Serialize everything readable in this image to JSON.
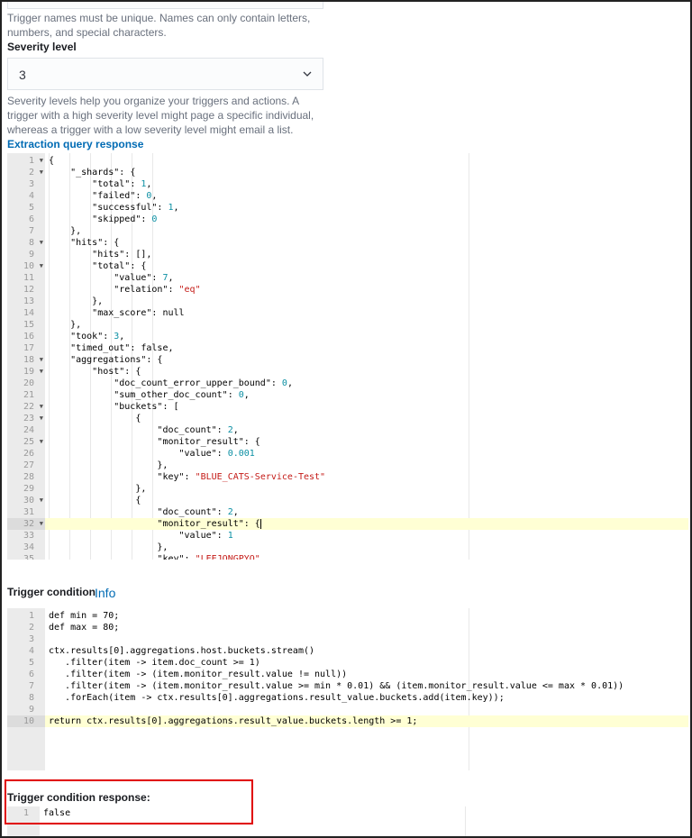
{
  "trigger_name": {
    "help_text": "Trigger names must be unique. Names can only contain letters, numbers, and special characters."
  },
  "severity": {
    "label": "Severity level",
    "value": "3",
    "help_text": "Severity levels help you organize your triggers and actions. A trigger with a high severity level might page a specific individual, whereas a trigger with a low severity level might email a list."
  },
  "extraction": {
    "label": "Extraction query response",
    "lines": [
      "{",
      "    \"_shards\": {",
      "        \"total\": 1,",
      "        \"failed\": 0,",
      "        \"successful\": 1,",
      "        \"skipped\": 0",
      "    },",
      "    \"hits\": {",
      "        \"hits\": [],",
      "        \"total\": {",
      "            \"value\": 7,",
      "            \"relation\": \"eq\"",
      "        },",
      "        \"max_score\": null",
      "    },",
      "    \"took\": 3,",
      "    \"timed_out\": false,",
      "    \"aggregations\": {",
      "        \"host\": {",
      "            \"doc_count_error_upper_bound\": 0,",
      "            \"sum_other_doc_count\": 0,",
      "            \"buckets\": [",
      "                {",
      "                    \"doc_count\": 2,",
      "                    \"monitor_result\": {",
      "                        \"value\": 0.001",
      "                    },",
      "                    \"key\": \"BLUE_CATS-Service-Test\"",
      "                },",
      "                {",
      "                    \"doc_count\": 2,",
      "                    \"monitor_result\": {",
      "                        \"value\": 1",
      "                    },",
      "                    \"key\": \"LEEJONGPYO\""
    ],
    "fold_lines": [
      1,
      2,
      8,
      10,
      18,
      19,
      22,
      23,
      25,
      30,
      32
    ],
    "active_line": 32
  },
  "trigger_condition": {
    "label": "Trigger condition",
    "info_link": "Info",
    "lines": [
      "def min = 70;",
      "def max = 80;",
      "",
      "ctx.results[0].aggregations.host.buckets.stream()",
      "   .filter(item -> item.doc_count >= 1)",
      "   .filter(item -> (item.monitor_result.value != null))",
      "   .filter(item -> (item.monitor_result.value >= min * 0.01) && (item.monitor_result.value <= max * 0.01))",
      "   .forEach(item -> ctx.results[0].aggregations.result_value.buckets.add(item.key));",
      "",
      "return ctx.results[0].aggregations.result_value.buckets.length >= 1;"
    ],
    "active_line": 10
  },
  "trigger_response": {
    "label": "Trigger condition response:",
    "lines": [
      "false"
    ]
  },
  "colors": {
    "link": "#006bb4",
    "highlight_border": "#e00000",
    "string": "#c41a16",
    "number": "#0b8fa3",
    "active_line": "#ffffd4"
  }
}
